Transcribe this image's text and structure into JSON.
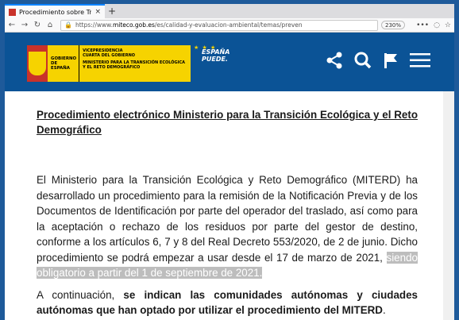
{
  "browser": {
    "tab_title": "Procedimiento sobre Tras",
    "tab_close": "×",
    "newtab": "+",
    "back": "←",
    "forward": "→",
    "reload": "↻",
    "home": "⌂",
    "url_prefix": "https://www.",
    "url_host": "miteco.gob.es",
    "url_path": "/es/calidad-y-evaluacion-ambiental/temas/preven",
    "zoom": "230%",
    "menu_dots": "•••"
  },
  "header": {
    "gov_text": "GOBIERNO DE ESPAÑA",
    "ministry_line1": "VICEPRESIDENCIA",
    "ministry_line2": "CUARTA DEL GOBIERNO",
    "ministry_line3": "MINISTERIO PARA LA TRANSICIÓN ECOLÓGICA Y EL RETO DEMOGRÁFICO",
    "espana_line1": "ESPAÑA",
    "espana_line2": "PUEDE.",
    "stars": "★ ★ ★"
  },
  "content": {
    "title": "Procedimiento electrónico Ministerio para la Transición Ecológica y el Reto Demográfico",
    "para1_main": "El Ministerio para la Transición Ecológica y Reto Demográfico (MITERD) ha desarrollado un procedimiento para la remisión de la Notificación Previa y de los Documentos de Identificación por parte del operador del traslado, así como para la aceptación o rechazo de los residuos por parte del gestor de destino, conforme a los artículos 6, 7 y 8 del Real Decreto 553/2020, de 2 de junio. Dicho procedimiento se podrá empezar a usar desde el 17 de marzo de 2021,",
    "para1_highlight": "siendo obligatorio a partir del 1 de septiembre de 2021.",
    "para2_start": "A continuación, ",
    "para2_bold": "se indican las comunidades autónomas y ciudades autónomas que han optado por utilizar el procedimiento del MITERD",
    "para2_end": "."
  }
}
